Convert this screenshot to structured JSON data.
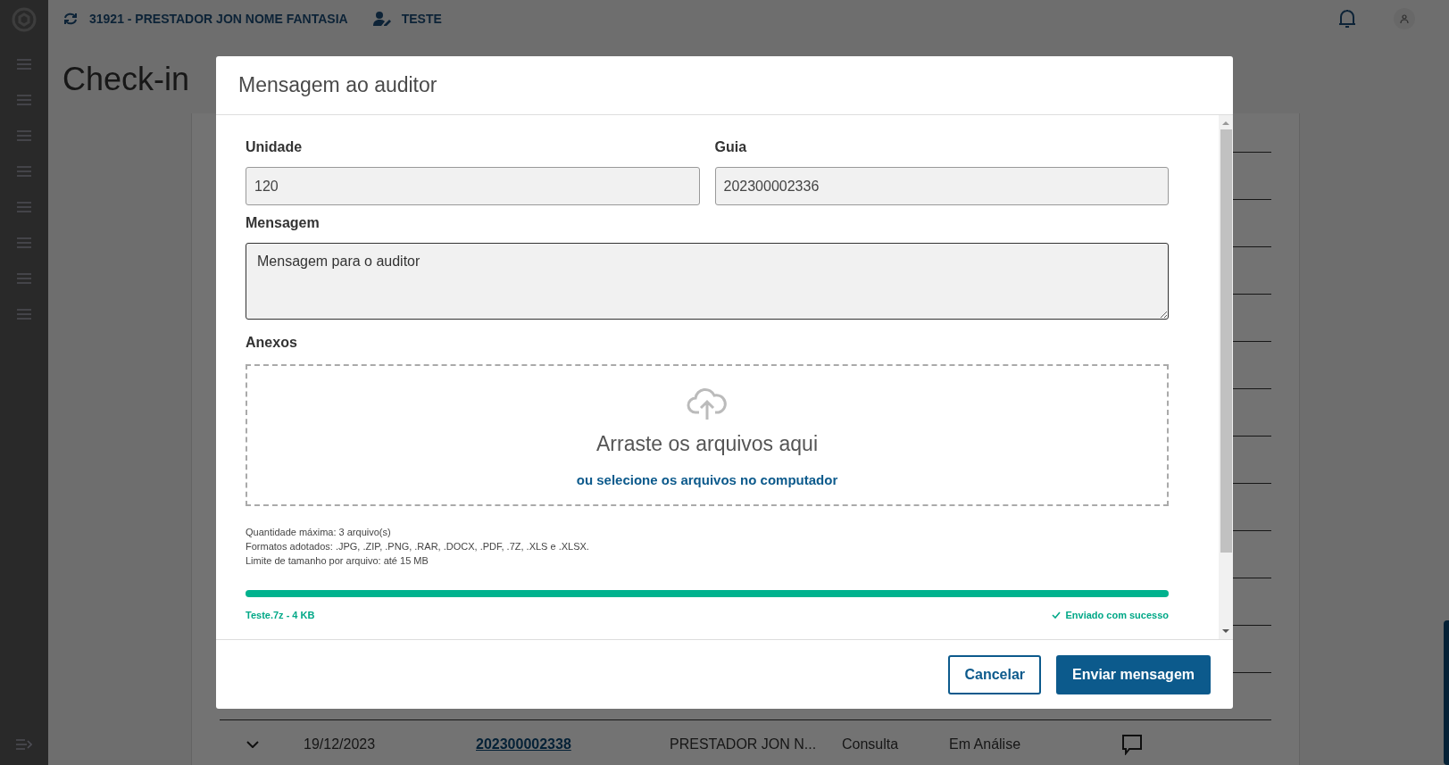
{
  "header": {
    "account": "31921 - PRESTADOR JON NOME FANTASIA",
    "user": "TESTE"
  },
  "page_title": "Check-in",
  "table_row": {
    "date": "19/12/2023",
    "guide": "202300002338",
    "provider": "PRESTADOR JON N...",
    "type": "Consulta",
    "status": "Em Análise"
  },
  "dialog": {
    "title": "Mensagem ao auditor",
    "fields": [
      {
        "label": "Unidade",
        "value": "120"
      },
      {
        "label": "Guia",
        "value": "202300002336"
      }
    ],
    "message": {
      "label": "Mensagem",
      "value": "Mensagem para o auditor"
    },
    "attachments": {
      "label": "Anexos",
      "drop_text": "Arraste os arquivos aqui",
      "select_link": "ou selecione os arquivos no computador",
      "rules": [
        "Quantidade máxima: 3 arquivo(s)",
        "Formatos adotados: .JPG, .ZIP, .PNG, .RAR, .DOCX, .PDF, .7Z, .XLS e .XLSX.",
        "Limite de tamanho por arquivo: até 15 MB"
      ],
      "files": [
        {
          "name": "Teste.7z - 4 KB",
          "status": "Enviado com sucesso",
          "level": 1
        }
      ]
    },
    "buttons": [
      {
        "label": "Cancelar",
        "kind": "secondary"
      },
      {
        "label": "Enviar mensagem",
        "kind": "primary"
      }
    ]
  }
}
